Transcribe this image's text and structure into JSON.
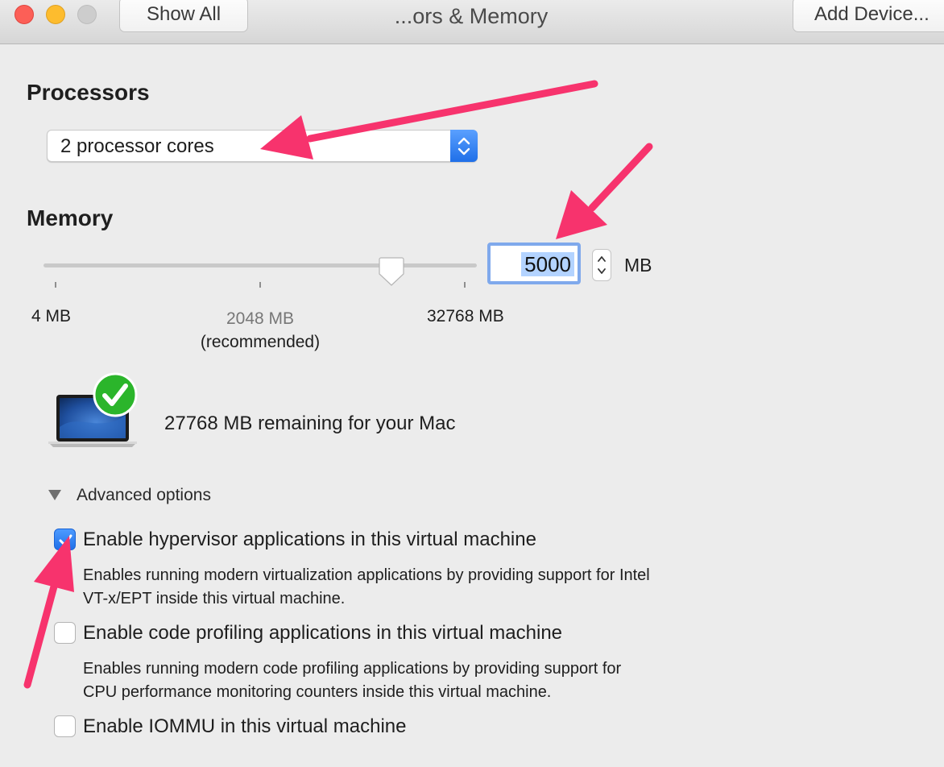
{
  "window": {
    "title": "...ors & Memory",
    "show_all_label": "Show All",
    "add_device_label": "Add Device..."
  },
  "processors": {
    "heading": "Processors",
    "selected": "2 processor cores"
  },
  "memory": {
    "heading": "Memory",
    "value": "5000",
    "unit": "MB",
    "slider": {
      "min_label": "4 MB",
      "mid_label": "2048 MB",
      "mid_note": "(recommended)",
      "max_label": "32768 MB",
      "level": 0.8
    },
    "remaining_text": "27768 MB remaining for your Mac"
  },
  "advanced": {
    "label": "Advanced options",
    "options": [
      {
        "label": "Enable hypervisor applications in this virtual machine",
        "checked": true,
        "description_line1": "Enables running modern virtualization applications by providing support for Intel",
        "description_line2": "VT-x/EPT inside this virtual machine."
      },
      {
        "label": "Enable code profiling applications in this virtual machine",
        "checked": false,
        "description_line1": "Enables running modern code profiling applications by providing support for",
        "description_line2": "CPU performance monitoring counters inside this virtual machine."
      },
      {
        "label": "Enable IOMMU in this virtual machine",
        "checked": false
      }
    ]
  },
  "colors": {
    "annotation_arrow": "#f7336d",
    "accent": "#1f6fe8",
    "success": "#2bb52b"
  },
  "icons": [
    "close-icon",
    "minimize-icon",
    "zoom-icon",
    "chevron-updown-icon",
    "slider-thumb-icon",
    "laptop-icon",
    "checkmark-badge-icon",
    "disclosure-triangle-icon",
    "checkmark-icon",
    "annotation-arrow-icon"
  ]
}
